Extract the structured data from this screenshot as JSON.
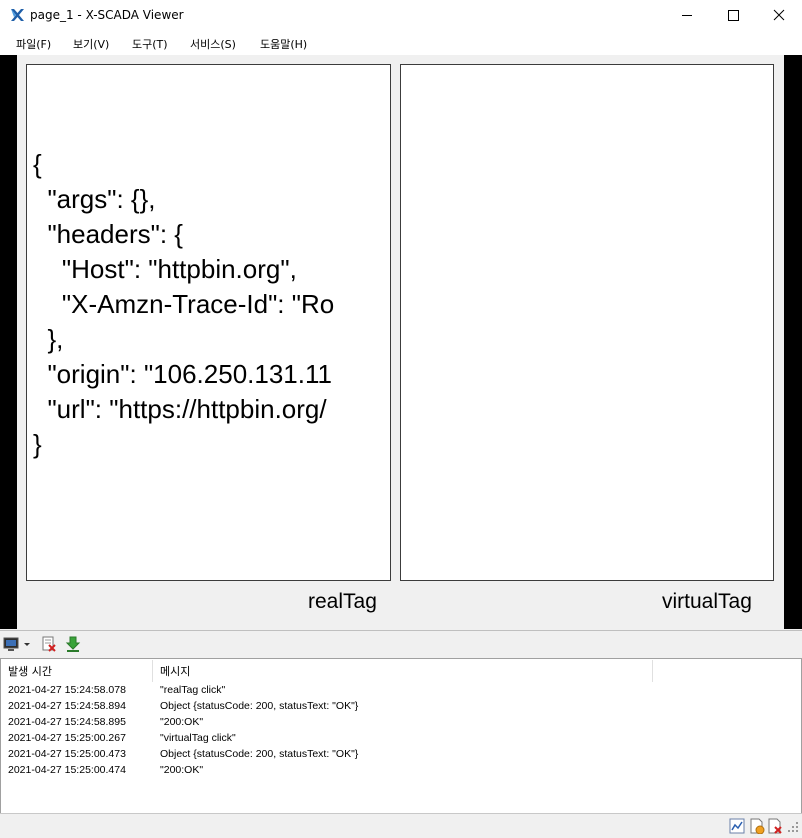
{
  "window": {
    "title": "page_1 - X-SCADA Viewer",
    "icons": {
      "app": "x-scada-logo-icon",
      "minimize": "minimize-icon",
      "maximize": "maximize-icon",
      "close": "close-icon"
    }
  },
  "menu": [
    {
      "label": "파일(F)"
    },
    {
      "label": "보기(V)"
    },
    {
      "label": "도구(T)"
    },
    {
      "label": "서비스(S)"
    },
    {
      "label": "도움말(H)"
    }
  ],
  "panels": {
    "real": {
      "json_lines": "{\n  \"args\": {},\n  \"headers\": {\n    \"Host\": \"httpbin.org\",\n    \"X-Amzn-Trace-Id\": \"Ro\n  },\n  \"origin\": \"106.250.131.11\n  \"url\": \"https://httpbin.org/\n}",
      "label": "realTag"
    },
    "virtual": {
      "label": "virtualTag"
    }
  },
  "log_toolbar": {
    "icons": [
      "monitor-icon",
      "dropdown-arrow-icon",
      "clear-log-icon",
      "download-icon"
    ]
  },
  "log": {
    "columns": [
      "발생 시간",
      "메시지"
    ],
    "rows": [
      {
        "time": "2021-04-27 15:24:58.078",
        "message": "\"realTag click\""
      },
      {
        "time": "2021-04-27 15:24:58.894",
        "message": "Object {statusCode: 200, statusText: \"OK\"}"
      },
      {
        "time": "2021-04-27 15:24:58.895",
        "message": "\"200:OK\""
      },
      {
        "time": "2021-04-27 15:25:00.267",
        "message": "\"virtualTag click\""
      },
      {
        "time": "2021-04-27 15:25:00.473",
        "message": "Object {statusCode: 200, statusText: \"OK\"}"
      },
      {
        "time": "2021-04-27 15:25:00.474",
        "message": "\"200:OK\""
      }
    ]
  },
  "statusbar": {
    "icons": [
      "chart-icon",
      "document-run-icon",
      "document-stop-icon",
      "resize-grip-icon"
    ]
  }
}
